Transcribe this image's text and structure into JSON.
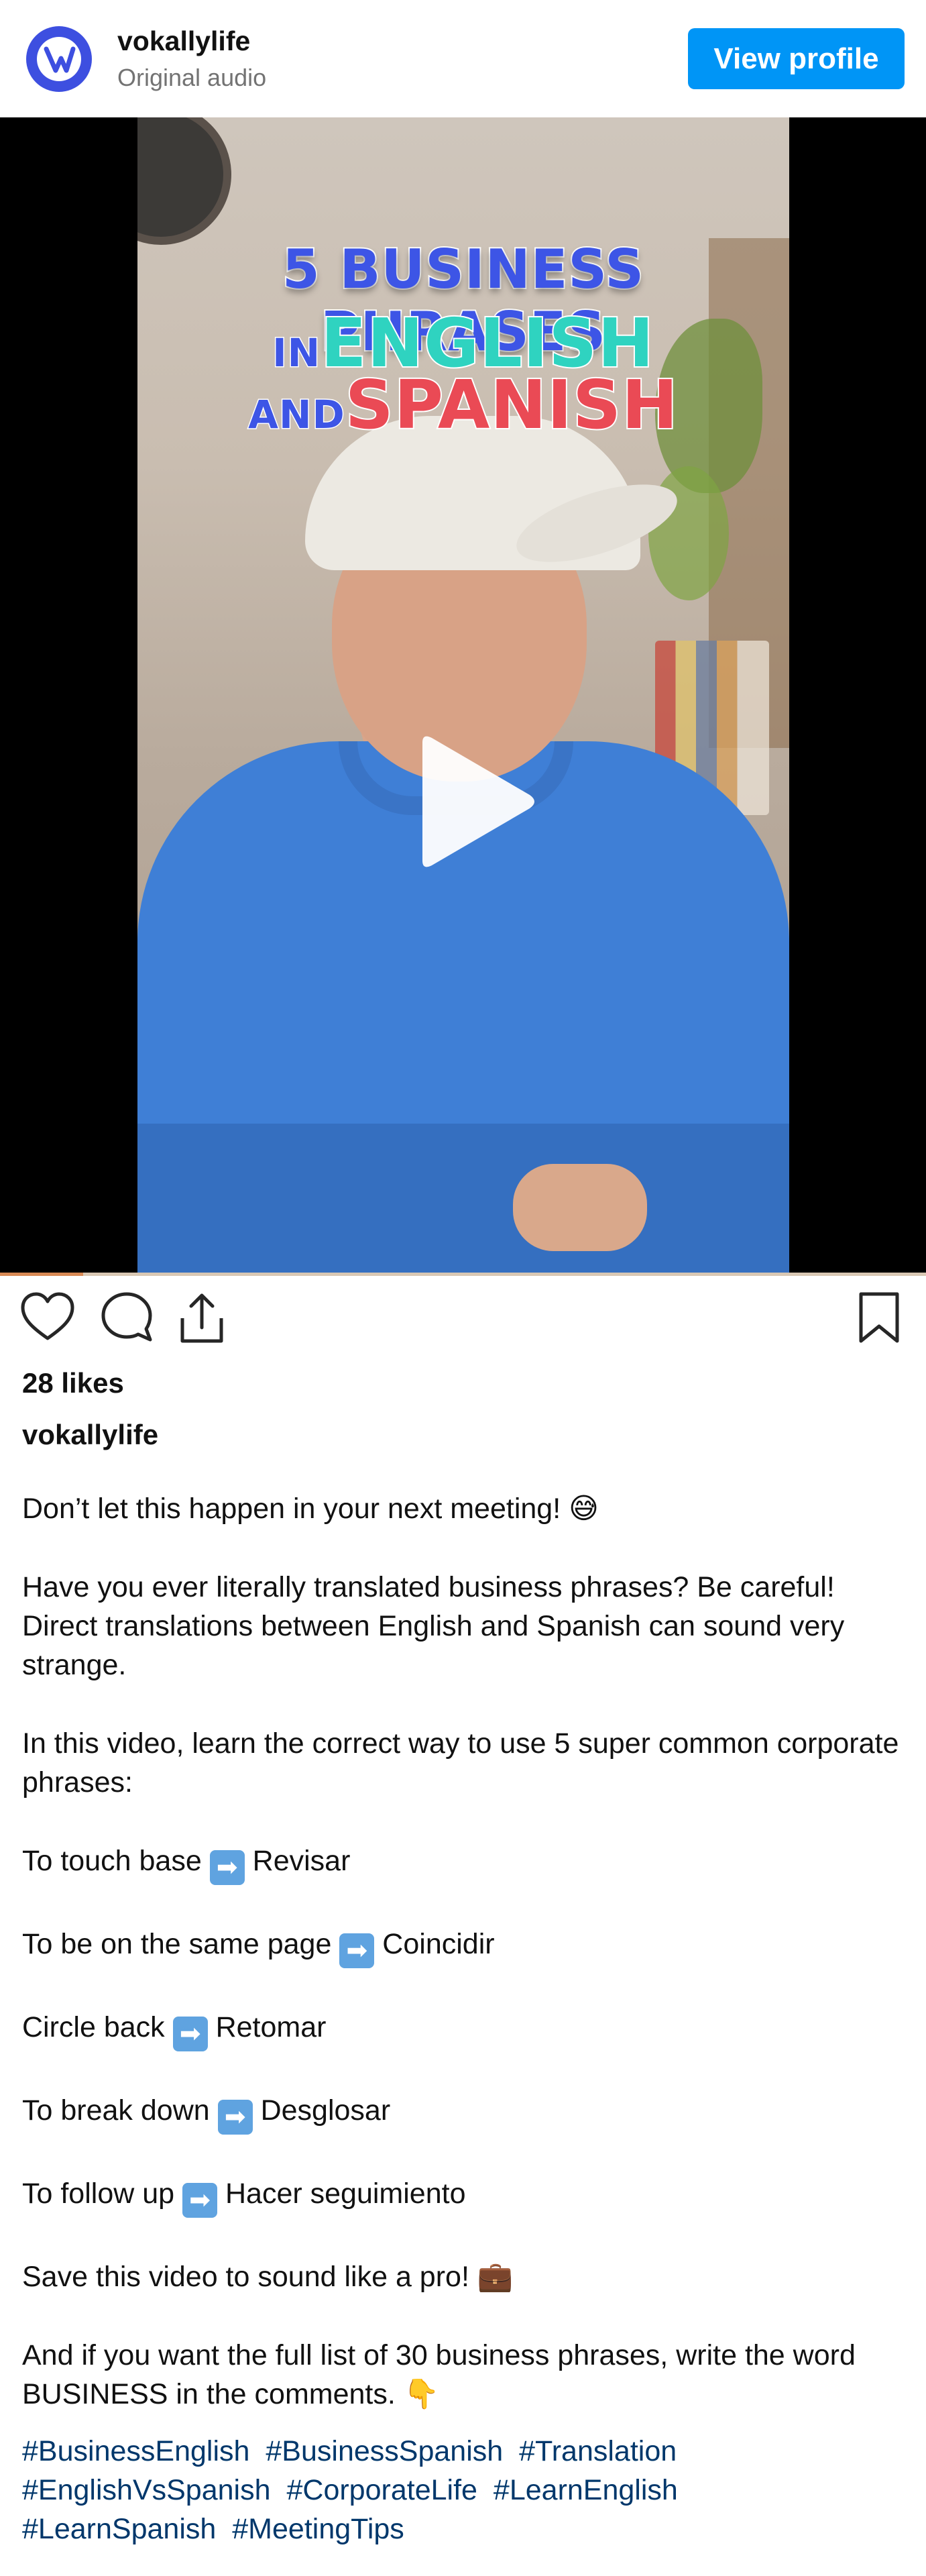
{
  "header": {
    "username": "vokallylife",
    "audio": "Original audio",
    "view_profile": "View profile"
  },
  "video": {
    "title_line1": "5 BUSINESS PHRASES",
    "title_line2_small": "IN",
    "title_line2_big": "ENGLISH",
    "title_line3_small": "AND",
    "title_line3_big": "SPANISH",
    "progress": 0.09
  },
  "post": {
    "likes": "28 likes",
    "caption_user": "vokallylife",
    "caption": {
      "line1": "Don’t let this happen in your next meeting! 😅",
      "para2": "Have you ever literally translated business phrases? Be careful! Direct translations between English and Spanish can sound very strange.",
      "para3": "In this video, learn the correct way to use 5 super common corporate phrases:",
      "phrases": [
        {
          "en": "To touch base",
          "es": "Revisar"
        },
        {
          "en": "To be on the same page",
          "es": "Coincidir"
        },
        {
          "en": "Circle back",
          "es": "Retomar"
        },
        {
          "en": "To break down",
          "es": "Desglosar"
        },
        {
          "en": "To follow up",
          "es": "Hacer seguimiento"
        }
      ],
      "arrow": "➡",
      "save_line": "Save this video to sound like a pro! 💼",
      "cta": "And if you want the full list of 30 business phrases, write the word BUSINESS in the comments. 👇"
    },
    "hashtags": [
      "#BusinessEnglish",
      "#BusinessSpanish",
      "#Translation",
      "#EnglishVsSpanish",
      "#CorporateLife",
      "#LearnEnglish",
      "#LearnSpanish",
      "#MeetingTips"
    ]
  },
  "icons": {
    "like": "heart-icon",
    "comment": "comment-icon",
    "share": "share-icon",
    "save": "bookmark-icon",
    "play": "play-icon"
  },
  "colors": {
    "accent": "#0095f6",
    "hashtag": "#00376b",
    "avatar": "#3d4fe0"
  }
}
